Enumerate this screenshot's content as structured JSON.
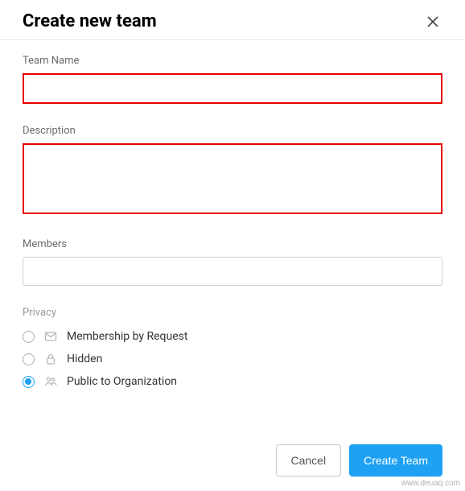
{
  "header": {
    "title": "Create new team"
  },
  "fields": {
    "teamName": {
      "label": "Team Name",
      "value": ""
    },
    "description": {
      "label": "Description",
      "value": ""
    },
    "members": {
      "label": "Members",
      "value": ""
    }
  },
  "privacy": {
    "label": "Privacy",
    "options": {
      "membership": "Membership by Request",
      "hidden": "Hidden",
      "public": "Public to Organization"
    },
    "selected": "public"
  },
  "footer": {
    "cancel": "Cancel",
    "create": "Create Team"
  },
  "watermark": "www.deuaq.com"
}
